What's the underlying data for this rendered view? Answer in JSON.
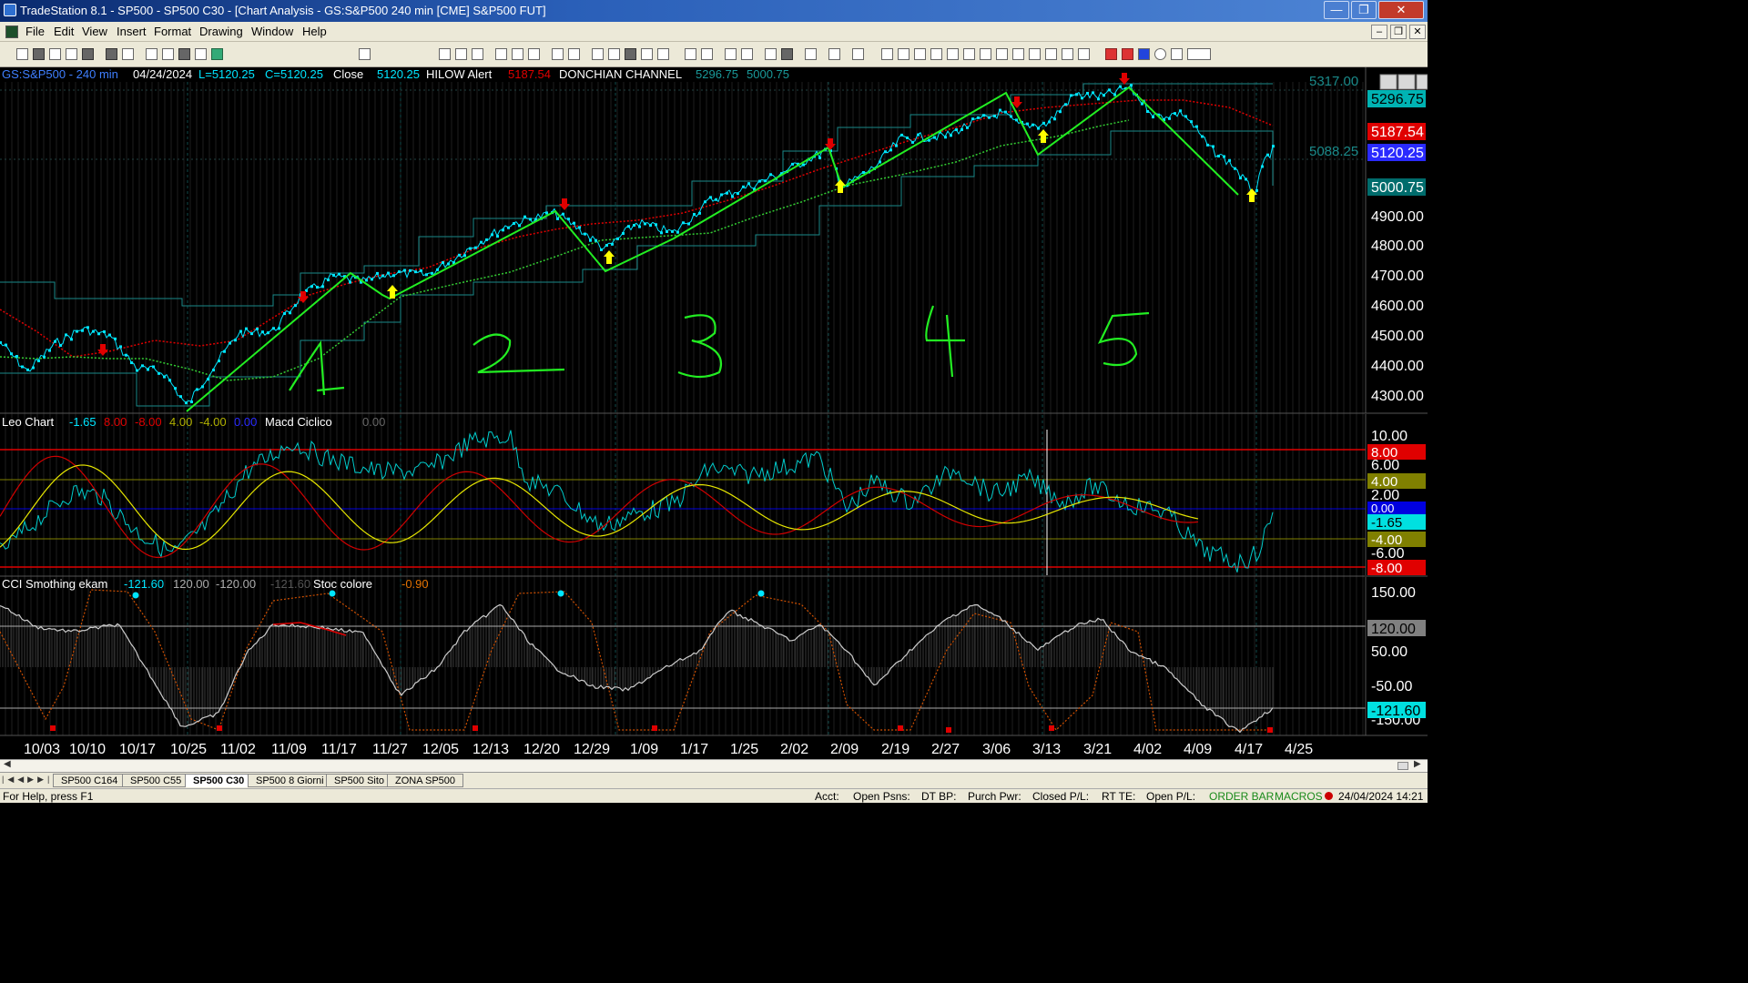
{
  "window": {
    "title": "TradeStation 8.1 - SP500 - SP500 C30 - [Chart Analysis - GS:S&P500  240 min  [CME] S&P500 FUT]",
    "minimize": "—",
    "maximize": "❐",
    "close": "✕"
  },
  "menu": [
    "File",
    "Edit",
    "View",
    "Insert",
    "Format",
    "Drawing",
    "Window",
    "Help"
  ],
  "mdi_controls": [
    "–",
    "❐",
    "✕"
  ],
  "toolbar": {
    "symbol_input": "b"
  },
  "main_panel": {
    "header": {
      "symbol": "GS:S&P500 - 240 min",
      "date": "04/24/2024",
      "low": "L=5120.25",
      "close_eq": "C=5120.25",
      "close_label": "Close",
      "close_value": "5120.25",
      "hilow_label": "HILOW Alert",
      "hilow_value": "5187.54",
      "donchian_label": "DONCHIAN CHANNEL",
      "donchian_upper": "5296.75",
      "donchian_lower": "5000.75"
    },
    "axis_labels": [
      "4900.00",
      "4800.00",
      "4700.00",
      "4600.00",
      "4500.00",
      "4400.00",
      "4300.00"
    ],
    "axis_partial": [
      "5317.00",
      "5088.25"
    ],
    "badges": [
      {
        "text": "5296.75",
        "bg": "#00b3b3",
        "fg": "#000"
      },
      {
        "text": "5187.54",
        "bg": "#e00000",
        "fg": "#fff"
      },
      {
        "text": "5120.25",
        "bg": "#2a2aff",
        "fg": "#fff"
      },
      {
        "text": "5000.75",
        "bg": "#006c6c",
        "fg": "#fff"
      }
    ],
    "wave_labels": [
      "1",
      "2",
      "3",
      "4",
      "5"
    ]
  },
  "osc_panel": {
    "header": {
      "name": "Leo Chart",
      "v1": "-1.65",
      "v2": "8.00",
      "v3": "-8.00",
      "v4": "4.00",
      "v5": "-4.00",
      "v6": "0.00",
      "name2": "Macd Ciclico",
      "v7": "0.00"
    },
    "axis_labels": [
      "10.00",
      "6.00",
      "2.00",
      "-6.00"
    ],
    "badges": [
      {
        "text": "8.00",
        "bg": "#e00000",
        "fg": "#fff"
      },
      {
        "text": "4.00",
        "bg": "#808000",
        "fg": "#fff"
      },
      {
        "text": "0.00",
        "bg": "#0000e0",
        "fg": "#fff"
      },
      {
        "text": "-1.65",
        "bg": "#00e0e0",
        "fg": "#000"
      },
      {
        "text": "-4.00",
        "bg": "#808000",
        "fg": "#fff"
      },
      {
        "text": "-8.00",
        "bg": "#e00000",
        "fg": "#fff"
      }
    ]
  },
  "cci_panel": {
    "header": {
      "name": "CCI Smothing ekam",
      "v1": "-121.60",
      "v2": "120.00",
      "v3": "-120.00",
      "v4": "-121.60",
      "name2": "Stoc colore",
      "v5": "-0.90"
    },
    "axis_labels": [
      "150.00",
      "50.00",
      "-50.00",
      "-150.00"
    ],
    "badges": [
      {
        "text": "120.00",
        "bg": "#808080",
        "fg": "#000"
      },
      {
        "text": "-121.60",
        "bg": "#00e0e0",
        "fg": "#000"
      }
    ]
  },
  "time_axis": [
    "10/03",
    "10/10",
    "10/17",
    "10/25",
    "11/02",
    "11/09",
    "11/17",
    "11/27",
    "12/05",
    "12/13",
    "12/20",
    "12/29",
    "1/09",
    "1/17",
    "1/25",
    "2/02",
    "2/09",
    "2/19",
    "2/27",
    "3/06",
    "3/13",
    "3/21",
    "4/02",
    "4/09",
    "4/17",
    "4/25"
  ],
  "sheet_tabs": [
    {
      "label": "SP500 C164",
      "active": false
    },
    {
      "label": "SP500 C55",
      "active": false
    },
    {
      "label": "SP500 C30",
      "active": true
    },
    {
      "label": "SP500 8 Giorni",
      "active": false
    },
    {
      "label": "SP500 Sito",
      "active": false
    },
    {
      "label": "ZONA SP500",
      "active": false
    }
  ],
  "status": {
    "help": "For Help, press F1",
    "acct": "Acct:",
    "open_psns": "Open Psns:",
    "dt_bp": "DT BP:",
    "purch_pwr": "Purch Pwr:",
    "closed_pl": "Closed P/L:",
    "rt_te": "RT TE:",
    "open_pl": "Open P/L:",
    "order_bar": "ORDER BAR",
    "macros": "MACROS",
    "datetime": "24/04/2024 14:21"
  },
  "colors": {
    "price": "#00e5ff",
    "trend": "#22ee22",
    "ma": "#33cc33",
    "channel": "#1a8a8a",
    "red": "#e00000",
    "yellow": "#ffff00"
  }
}
